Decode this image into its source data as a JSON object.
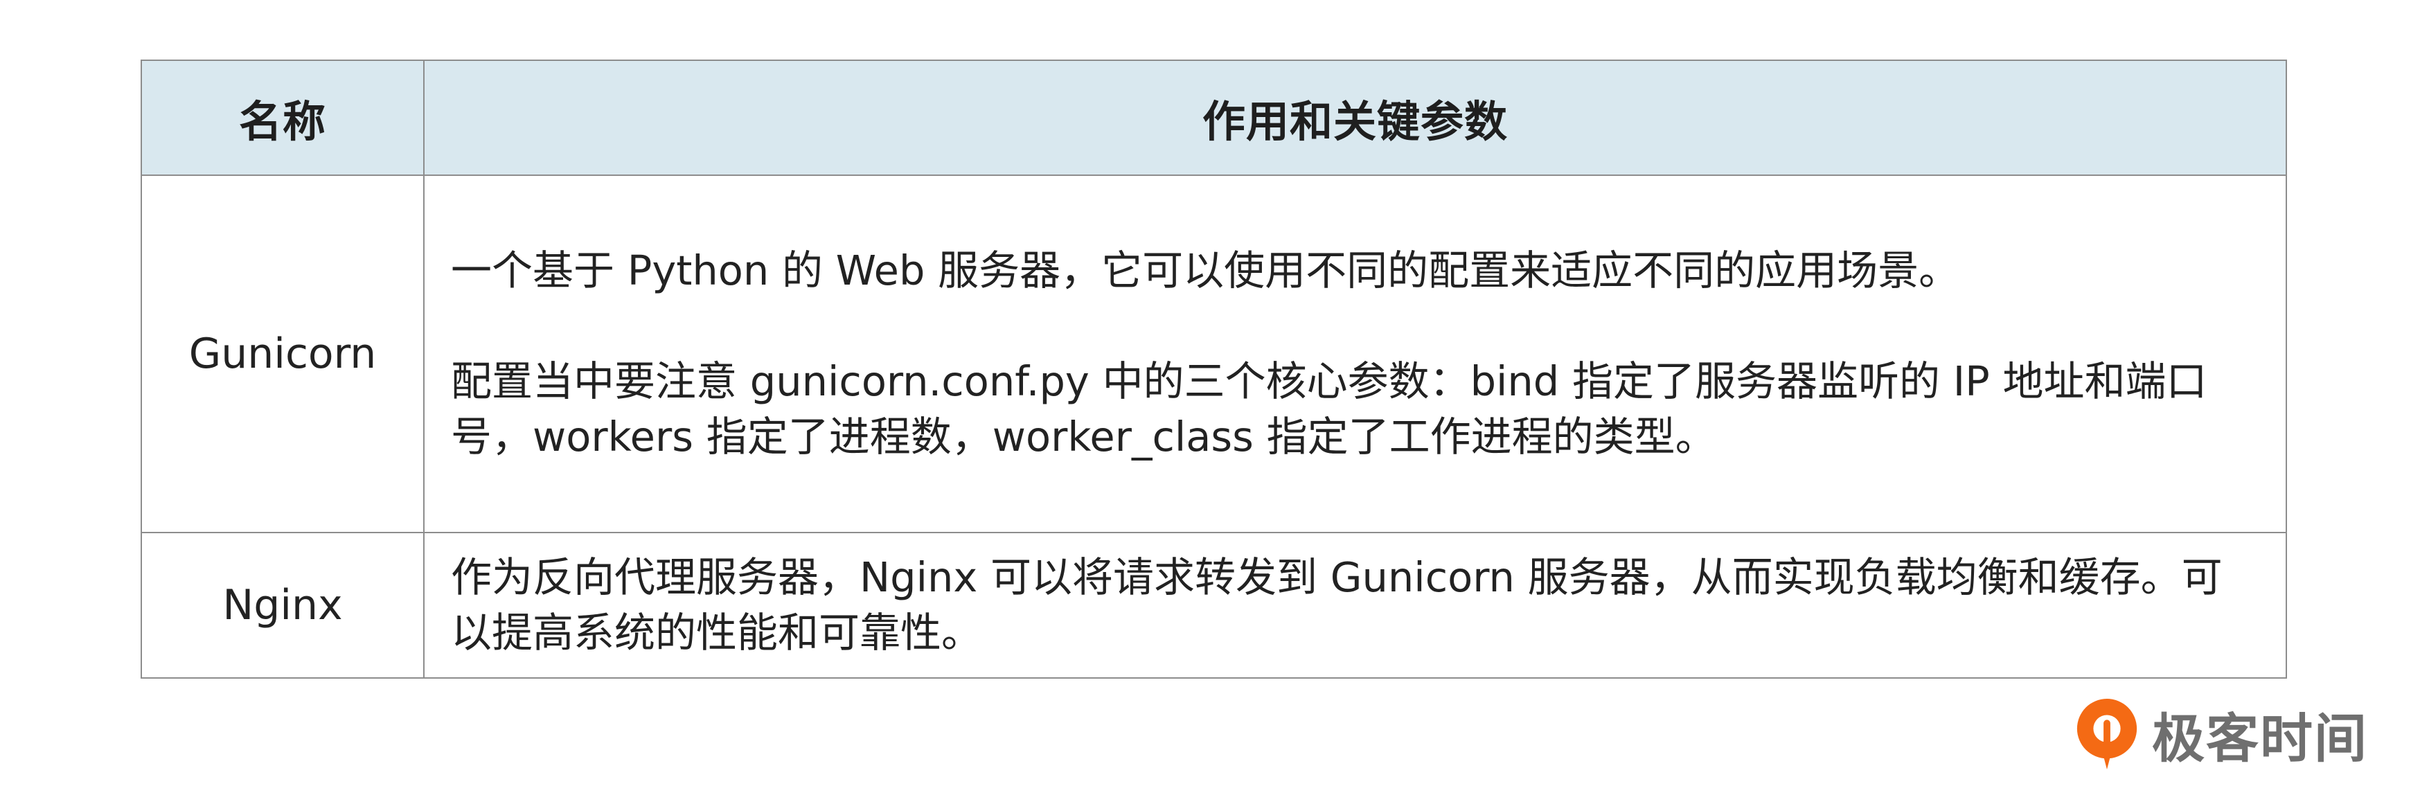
{
  "table": {
    "headers": {
      "name": "名称",
      "description": "作用和关键参数"
    },
    "rows": [
      {
        "name": "Gunicorn",
        "paragraphs": [
          "一个基于 Python 的 Web 服务器，它可以使用不同的配置来适应不同的应用场景。",
          "配置当中要注意 gunicorn.conf.py 中的三个核心参数：bind 指定了服务器监听的 IP 地址和端口号，workers 指定了进程数，worker_class 指定了工作进程的类型。"
        ]
      },
      {
        "name": "Nginx",
        "paragraphs": [
          "作为反向代理服务器，Nginx 可以将请求转发到 Gunicorn 服务器，从而实现负载均衡和缓存。可以提高系统的性能和可靠性。"
        ]
      }
    ]
  },
  "logo": {
    "text": "极客时间",
    "icon": "geektime-logo-icon",
    "color": "#f46a14"
  },
  "colors": {
    "header_bg": "#d9e8ef",
    "border": "#8d8d8d"
  }
}
